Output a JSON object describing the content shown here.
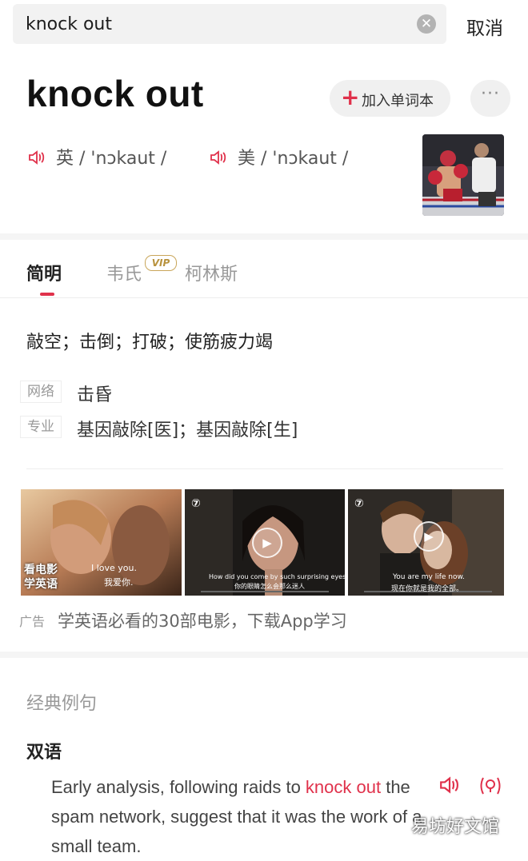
{
  "search": {
    "query": "knock out",
    "cancel_label": "取消"
  },
  "header": {
    "word": "knock out",
    "add_label": "加入单词本",
    "more_label": "···",
    "uk_label": "英",
    "uk_phonetic": "/ 'nɔkaut /",
    "us_label": "美",
    "us_phonetic": "/ 'nɔkaut /"
  },
  "tabs": [
    {
      "label": "简明",
      "active": true
    },
    {
      "label": "韦氏",
      "badge": "VIP"
    },
    {
      "label": "柯林斯"
    }
  ],
  "definition": {
    "main": "敲空；击倒；打破；使筋疲力竭",
    "rows": [
      {
        "tag": "网络",
        "text": "击昏"
      },
      {
        "tag": "专业",
        "text": "基因敲除[医]；基因敲除[生]"
      }
    ]
  },
  "ad": {
    "videos": [
      {
        "overlay": "看电影\n学英语",
        "sub_en": "I love you.",
        "sub_cn": "我爱你."
      },
      {
        "sub_en": "How did you come by such surprising eyes?",
        "sub_cn": "你的眼睛怎么会那么迷人"
      },
      {
        "sub_en": "You are my life now.",
        "sub_cn": "现在你就是我的全部。"
      }
    ],
    "tag": "广告",
    "text": "学英语必看的30部电影，下载App学习"
  },
  "examples": {
    "section_title": "经典例句",
    "type_label": "双语",
    "sentence_before": "Early analysis, following raids to ",
    "sentence_highlight": "knock out",
    "sentence_after": " the spam network, suggest that it was the work of a small team."
  },
  "watermark": "易坊好文馆",
  "colors": {
    "accent": "#e0314b"
  }
}
